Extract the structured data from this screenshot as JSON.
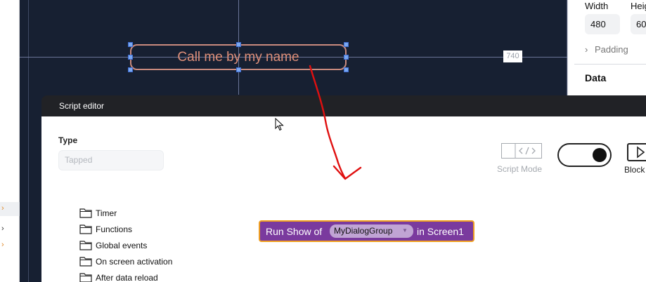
{
  "canvas": {
    "button_label": "Call me by my name",
    "guide_value": "740"
  },
  "properties": {
    "width_label": "Width",
    "width_value": "480",
    "height_label": "Heig",
    "height_value": "60",
    "padding_label": "Padding",
    "data_heading": "Data"
  },
  "script_editor": {
    "title": "Script editor",
    "type_label": "Type",
    "type_placeholder": "Tapped",
    "script_mode_label": "Script Mode",
    "blocks_label": "Block",
    "tree_items": [
      {
        "label": "Timer"
      },
      {
        "label": "Functions"
      },
      {
        "label": "Global events"
      },
      {
        "label": "On screen activation"
      },
      {
        "label": "After data reload"
      }
    ],
    "block": {
      "prefix": "Run Show of",
      "dropdown_value": "MyDialogGroup",
      "suffix": "in Screen1"
    }
  },
  "colors": {
    "canvas_bg": "#172032",
    "block_fill": "#7a3a9e",
    "block_border": "#f0a020",
    "annotation": "#e01010",
    "button_text": "#e0907a"
  }
}
